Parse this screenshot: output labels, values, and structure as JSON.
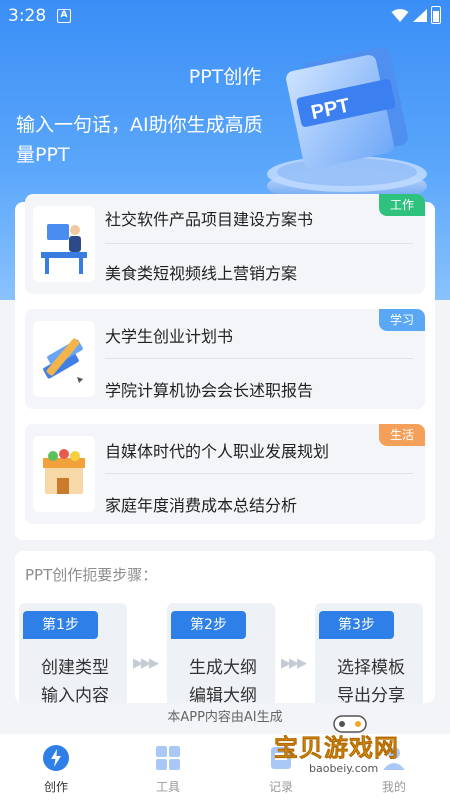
{
  "status_bar": {
    "time": "3:28",
    "notification_icon": "A"
  },
  "header": {
    "title": "PPT创作",
    "slogan": "输入一句话，AI助你生成高质量PPT",
    "illustration_text": "PPT"
  },
  "cards": [
    {
      "tag": "工作",
      "tag_color": "#2ec27e",
      "thumb_icon": "office-worker-icon",
      "items": [
        "社交软件产品项目建设方案书",
        "美食类短视频线上营销方案"
      ]
    },
    {
      "tag": "学习",
      "tag_color": "#5aa8f5",
      "thumb_icon": "books-pencil-icon",
      "items": [
        "大学生创业计划书",
        "学院计算机协会会长述职报告"
      ]
    },
    {
      "tag": "生活",
      "tag_color": "#f5a05a",
      "thumb_icon": "shop-icon",
      "items": [
        "自媒体时代的个人职业发展规划",
        "家庭年度消费成本总结分析"
      ]
    }
  ],
  "steps": {
    "heading": "PPT创作扼要步骤：",
    "items": [
      {
        "badge": "第1步",
        "line1": "创建类型",
        "line2": "输入内容"
      },
      {
        "badge": "第2步",
        "line1": "生成大纲",
        "line2": "编辑大纲"
      },
      {
        "badge": "第3步",
        "line1": "选择模板",
        "line2": "导出分享"
      }
    ]
  },
  "notice": "本APP内容由AI生成",
  "tabs": [
    {
      "label": "创作",
      "icon": "lightning-icon",
      "active": true
    },
    {
      "label": "工具",
      "icon": "grid-icon",
      "active": false
    },
    {
      "label": "记录",
      "icon": "history-icon",
      "active": false
    },
    {
      "label": "我的",
      "icon": "profile-icon",
      "active": false
    }
  ],
  "watermark": {
    "title": "宝贝游戏网",
    "url": "baobeiy.com"
  },
  "colors": {
    "primary": "#2f7fe8",
    "hero_top": "#3a8ef6",
    "hero_bottom": "#89c2fd"
  }
}
